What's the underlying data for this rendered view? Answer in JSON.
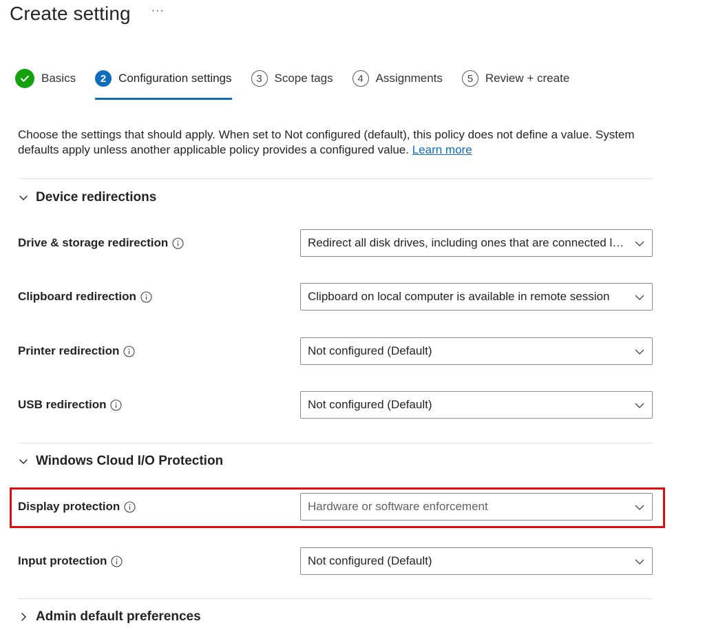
{
  "header": {
    "title": "Create setting",
    "more_label": "···"
  },
  "steps": [
    {
      "number": "",
      "label": "Basics",
      "state": "complete"
    },
    {
      "number": "2",
      "label": "Configuration settings",
      "state": "active"
    },
    {
      "number": "3",
      "label": "Scope tags",
      "state": "pending"
    },
    {
      "number": "4",
      "label": "Assignments",
      "state": "pending"
    },
    {
      "number": "5",
      "label": "Review + create",
      "state": "pending"
    }
  ],
  "intro": {
    "text": "Choose the settings that should apply. When set to Not configured (default), this policy does not define a value. System defaults apply unless another applicable policy provides a configured value.",
    "link": "Learn more"
  },
  "sections": {
    "device_redirections": {
      "title": "Device redirections",
      "rows": [
        {
          "label": "Drive & storage redirection",
          "value": "Redirect all disk drives, including ones that are connected later"
        },
        {
          "label": "Clipboard redirection",
          "value": "Clipboard on local computer is available in remote session"
        },
        {
          "label": "Printer redirection",
          "value": "Not configured (Default)"
        },
        {
          "label": "USB redirection",
          "value": "Not configured (Default)"
        }
      ]
    },
    "cloud_io": {
      "title": "Windows Cloud I/O Protection",
      "rows": [
        {
          "label": "Display protection",
          "value": "Hardware or software enforcement"
        },
        {
          "label": "Input protection",
          "value": "Not configured (Default)"
        }
      ]
    },
    "admin_defaults": {
      "title": "Admin default preferences"
    }
  },
  "colors": {
    "accent": "#0f6cbd",
    "success": "#13a10e",
    "highlight": "#e00b0b"
  }
}
